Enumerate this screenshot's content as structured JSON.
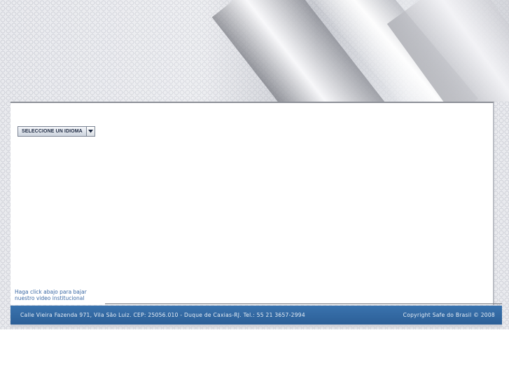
{
  "language_selector": {
    "label": "SELECCIONE UN IDIOMA",
    "icon": "chevron-down-icon"
  },
  "video_link": {
    "line1": "Haga click abajo para bajar",
    "line2": "nuestro video institucional"
  },
  "footer": {
    "address": "Calle Vieira Fazenda 971, Vila São Luiz. CEP: 25056.010 - Duque de Caxias-RJ. Tel.: 55 21 3657-2994",
    "copyright": "Copyright Safe do Brasil © 2008"
  },
  "colors": {
    "footer_bar": "#2f6aa3",
    "link_text": "#3a68a4",
    "background_pattern": "#e9eaee"
  }
}
